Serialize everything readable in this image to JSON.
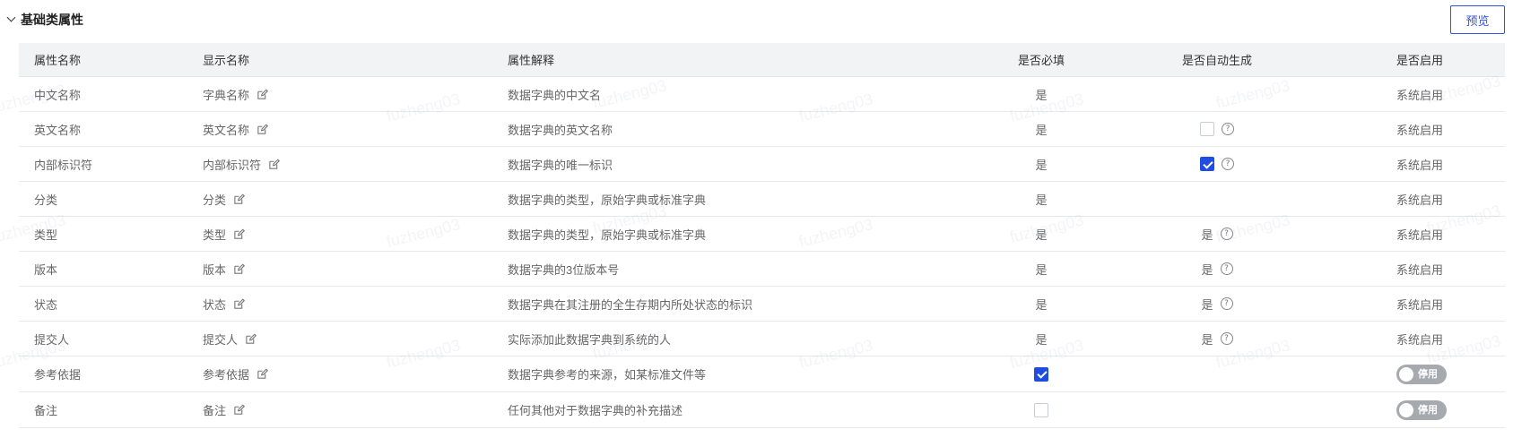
{
  "section": {
    "title": "基础类属性",
    "preview_label": "预览"
  },
  "watermark": "fuzheng03",
  "table": {
    "headers": [
      "属性名称",
      "显示名称",
      "属性解释",
      "是否必填",
      "是否自动生成",
      "是否启用"
    ],
    "rows": [
      {
        "name": "中文名称",
        "display": "字典名称",
        "desc": "数据字典的中文名",
        "required": "是",
        "auto": null,
        "enabled": "系统启用"
      },
      {
        "name": "英文名称",
        "display": "英文名称",
        "desc": "数据字典的英文名称",
        "required": "是",
        "auto": "checkbox-off",
        "enabled": "系统启用"
      },
      {
        "name": "内部标识符",
        "display": "内部标识符",
        "desc": "数据字典的唯一标识",
        "required": "是",
        "auto": "checkbox-on",
        "enabled": "系统启用"
      },
      {
        "name": "分类",
        "display": "分类",
        "desc": "数据字典的类型，原始字典或标准字典",
        "required": "是",
        "auto": null,
        "enabled": "系统启用"
      },
      {
        "name": "类型",
        "display": "类型",
        "desc": "数据字典的类型，原始字典或标准字典",
        "required": "是",
        "auto": "是",
        "enabled": "系统启用"
      },
      {
        "name": "版本",
        "display": "版本",
        "desc": "数据字典的3位版本号",
        "required": "是",
        "auto": "是",
        "enabled": "系统启用"
      },
      {
        "name": "状态",
        "display": "状态",
        "desc": "数据字典在其注册的全生存期内所处状态的标识",
        "required": "是",
        "auto": "是",
        "enabled": "系统启用"
      },
      {
        "name": "提交人",
        "display": "提交人",
        "desc": "实际添加此数据字典到系统的人",
        "required": "是",
        "auto": "是",
        "enabled": "系统启用"
      },
      {
        "name": "参考依据",
        "display": "参考依据",
        "desc": "数据字典参考的来源，如某标准文件等",
        "required": "checkbox-on",
        "auto": null,
        "enabled": "停用"
      },
      {
        "name": "备注",
        "display": "备注",
        "desc": "任何其他对于数据字典的补充描述",
        "required": "checkbox-off",
        "auto": null,
        "enabled": "停用"
      }
    ]
  },
  "colors": {
    "accent": "#2f54eb",
    "checkbox_on": "#1f4ddf",
    "header_bg": "#f2f3f5",
    "toggle_off": "#a6a9ae"
  }
}
